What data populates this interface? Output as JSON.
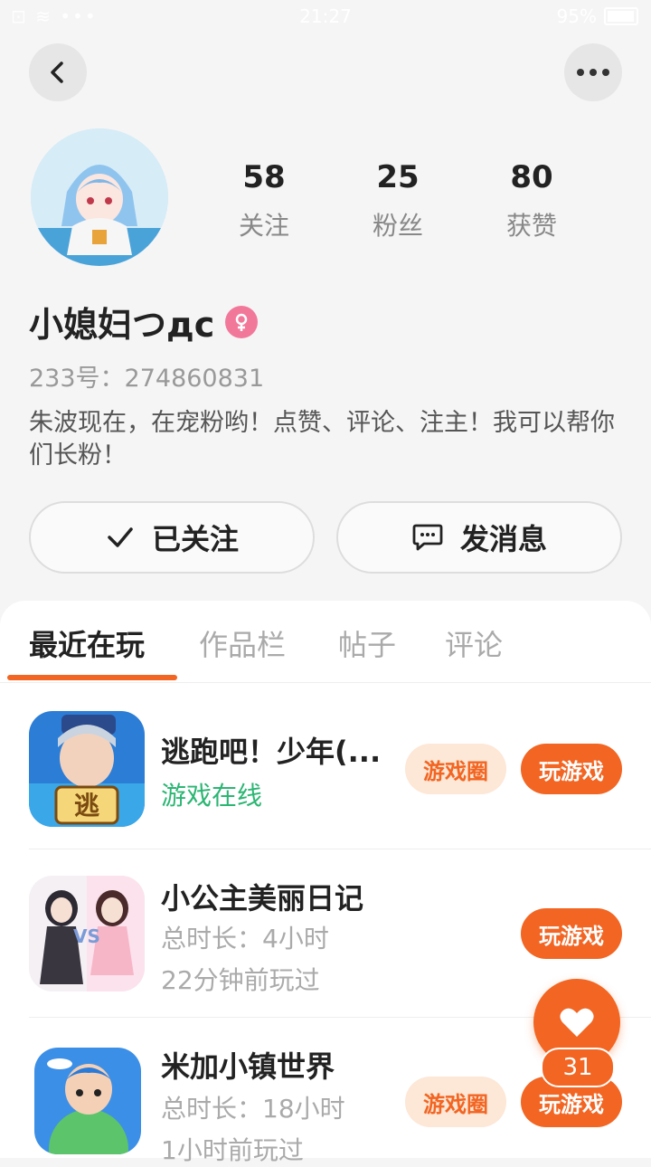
{
  "status_bar": {
    "left": "⊡ ≋ •••",
    "time": "21:27",
    "battery": "95%"
  },
  "profile": {
    "stats": [
      {
        "value": "58",
        "label": "关注"
      },
      {
        "value": "25",
        "label": "粉丝"
      },
      {
        "value": "80",
        "label": "获赞"
      }
    ],
    "name": "小媳妇つдс",
    "uid": "233号：274860831",
    "bio": "朱波现在，在宠粉哟！点赞、评论、注主！我可以帮你们长粉！"
  },
  "actions": {
    "follow_label": "已关注",
    "message_label": "发消息"
  },
  "tabs": [
    "最近在玩",
    "作品栏",
    "帖子",
    "评论"
  ],
  "games": [
    {
      "title": "逃跑吧！少年(...",
      "sub1": "游戏在线",
      "circle_btn": "游戏圈",
      "play_btn": "玩游戏"
    },
    {
      "title": "小公主美丽日记",
      "sub1": "总时长：4小时",
      "sub2": "22分钟前玩过",
      "play_btn": "玩游戏"
    },
    {
      "title": "米加小镇世界",
      "sub1": "总时长：18小时",
      "sub2": "1小时前玩过",
      "circle_btn": "游戏圈",
      "play_btn": "玩游戏"
    }
  ],
  "fab": {
    "count": "31"
  },
  "colors": {
    "accent": "#f26522",
    "online": "#2bb673",
    "female": "#f2789a"
  }
}
